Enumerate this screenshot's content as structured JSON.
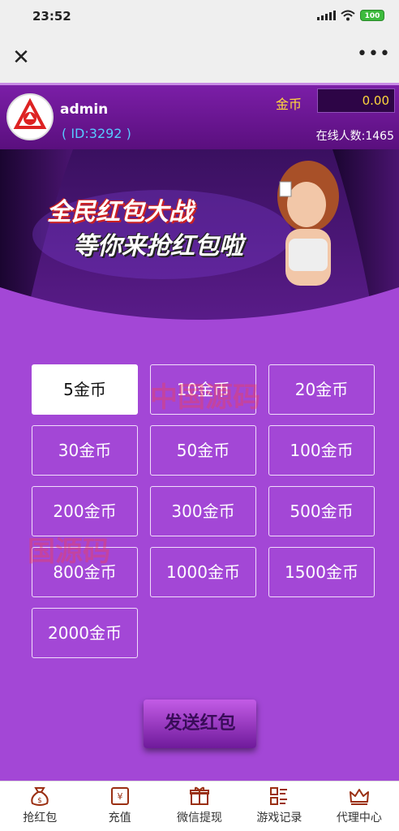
{
  "status": {
    "time": "23:52",
    "battery": "100"
  },
  "header": {
    "username": "admin",
    "user_id": "( ID:3292 )",
    "coin_label": "金币",
    "coin_value": "0.00",
    "online_label": "在线人数:",
    "online_count": "1465"
  },
  "banner": {
    "line1": "全民红包大战",
    "line2": "等你来抢红包啦"
  },
  "amounts": [
    {
      "label": "5金币",
      "selected": true
    },
    {
      "label": "10金币"
    },
    {
      "label": "20金币"
    },
    {
      "label": "30金币"
    },
    {
      "label": "50金币"
    },
    {
      "label": "100金币"
    },
    {
      "label": "200金币"
    },
    {
      "label": "300金币"
    },
    {
      "label": "500金币"
    },
    {
      "label": "800金币"
    },
    {
      "label": "1000金币"
    },
    {
      "label": "1500金币"
    },
    {
      "label": "2000金币"
    }
  ],
  "send_button": "发送红包",
  "tabs": [
    {
      "label": "抢红包",
      "icon": "money-bag-icon"
    },
    {
      "label": "充值",
      "icon": "yen-ticket-icon"
    },
    {
      "label": "微信提现",
      "icon": "gift-icon"
    },
    {
      "label": "游戏记录",
      "icon": "records-icon"
    },
    {
      "label": "代理中心",
      "icon": "crown-icon"
    }
  ],
  "watermark": "中国源码",
  "colors": {
    "background": "#a347d6",
    "header": "#7b1ea7",
    "coin_text": "#ffd83c",
    "id_text": "#58c9ff"
  }
}
